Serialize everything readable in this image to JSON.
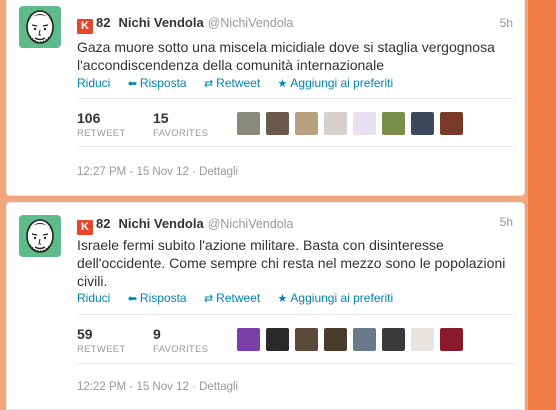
{
  "tweets": [
    {
      "klout_score": "82",
      "name": "Nichi Vendola",
      "handle": "@NichiVendola",
      "time": "5h",
      "text": "Gaza muore sotto una miscela micidiale dove si staglia vergognosa l'accondiscendenza della comunità internazionale",
      "actions": {
        "reply": "Riduci",
        "respond": "Risposta",
        "retweet": "Retweet",
        "favorite": "Aggiungi ai preferiti"
      },
      "retweets": "106",
      "retweet_label": "RETWEET",
      "favorites": "15",
      "favorites_label": "FAVORITES",
      "timestamp": "12:27 PM - 15 Nov 12",
      "details": "Dettagli",
      "face_colors": [
        "#8a8a7a",
        "#6b5a4a",
        "#b6a27f",
        "#d8d0c8",
        "#e6e0f0",
        "#7a8f4a",
        "#3a4a5a",
        "#7a3a2a"
      ]
    },
    {
      "klout_score": "82",
      "name": "Nichi Vendola",
      "handle": "@NichiVendola",
      "time": "5h",
      "text": "Israele fermi subito l'azione militare. Basta con disinteresse dell'occidente. Come sempre chi resta nel mezzo sono le popolazioni civili.",
      "actions": {
        "reply": "Riduci",
        "respond": "Risposta",
        "retweet": "Retweet",
        "favorite": "Aggiungi ai preferiti"
      },
      "retweets": "59",
      "retweet_label": "RETWEET",
      "favorites": "9",
      "favorites_label": "FAVORITES",
      "timestamp": "12:22 PM - 15 Nov 12",
      "details": "Dettagli",
      "face_colors": [
        "#7a3fa8",
        "#2a2a2a",
        "#5a4a3a",
        "#4a3a2a",
        "#6a7a8a",
        "#3a3a3a",
        "#e8e4e0",
        "#8a1a2a"
      ]
    }
  ]
}
